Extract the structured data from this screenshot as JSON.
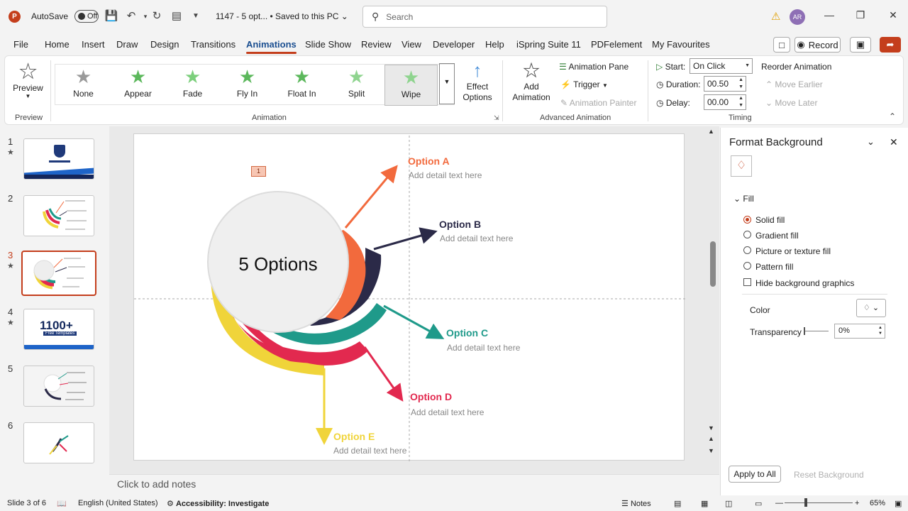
{
  "titlebar": {
    "app_logo": "P",
    "autosave_label": "AutoSave",
    "autosave_state": "Off",
    "doc_title": "1147 - 5 opt... • Saved to this PC",
    "search_placeholder": "Search",
    "avatar_initials": "AR"
  },
  "menu": {
    "tabs": [
      "File",
      "Home",
      "Insert",
      "Draw",
      "Design",
      "Transitions",
      "Animations",
      "Slide Show",
      "Review",
      "View",
      "Developer",
      "Help",
      "iSpring Suite 11",
      "PDFelement",
      "My Favourites"
    ],
    "active_tab": "Animations",
    "record_label": "Record"
  },
  "ribbon": {
    "preview_label": "Preview",
    "preview_group": "Preview",
    "animation_group": "Animation",
    "animations": [
      {
        "label": "None",
        "color": "#9a9a9a"
      },
      {
        "label": "Appear",
        "color": "#5cb85c"
      },
      {
        "label": "Fade",
        "color": "#7ccf7c"
      },
      {
        "label": "Fly In",
        "color": "#5cb85c"
      },
      {
        "label": "Float In",
        "color": "#5cb85c"
      },
      {
        "label": "Split",
        "color": "#8fd48f"
      },
      {
        "label": "Wipe",
        "color": "#8fd48f"
      }
    ],
    "effect_options": "Effect Options",
    "add_animation": "Add Animation",
    "animation_pane": "Animation Pane",
    "trigger": "Trigger",
    "animation_painter": "Animation Painter",
    "advanced_group": "Advanced Animation",
    "start_label": "Start:",
    "start_value": "On Click",
    "duration_label": "Duration:",
    "duration_value": "00.50",
    "delay_label": "Delay:",
    "delay_value": "00.00",
    "timing_group": "Timing",
    "reorder_label": "Reorder Animation",
    "move_earlier": "Move Earlier",
    "move_later": "Move Later"
  },
  "thumbnails": [
    {
      "num": "1",
      "star": true
    },
    {
      "num": "2",
      "star": false
    },
    {
      "num": "3",
      "star": true,
      "active": true
    },
    {
      "num": "4",
      "star": true
    },
    {
      "num": "5",
      "star": false
    },
    {
      "num": "6",
      "star": false
    }
  ],
  "thumb4_text": {
    "big": "1100+",
    "small": "Free Templates"
  },
  "slide": {
    "anim_marker": "1",
    "center_title": "5 Options",
    "options": [
      {
        "title": "Option A",
        "detail": "Add detail text here",
        "color": "#f26a3d"
      },
      {
        "title": "Option B",
        "detail": "Add detail text here",
        "color": "#2b2a48"
      },
      {
        "title": "Option C",
        "detail": "Add detail text here",
        "color": "#1f9a8a"
      },
      {
        "title": "Option D",
        "detail": "Add detail text here",
        "color": "#e2294f"
      },
      {
        "title": "Option E",
        "detail": "Add detail text here",
        "color": "#f0d43a"
      }
    ]
  },
  "notes_placeholder": "Click to add notes",
  "pane": {
    "title": "Format Background",
    "fill_header": "Fill",
    "fill_options": [
      "Solid fill",
      "Gradient fill",
      "Picture or texture fill",
      "Pattern fill"
    ],
    "selected_fill": "Solid fill",
    "hide_bg_graphics": "Hide background graphics",
    "color_label": "Color",
    "transparency_label": "Transparency",
    "transparency_value": "0%",
    "apply_all": "Apply to All",
    "reset_bg": "Reset Background"
  },
  "status": {
    "slide_info": "Slide 3 of 6",
    "language": "English (United States)",
    "accessibility": "Accessibility: Investigate",
    "notes": "Notes",
    "zoom": "65%"
  }
}
